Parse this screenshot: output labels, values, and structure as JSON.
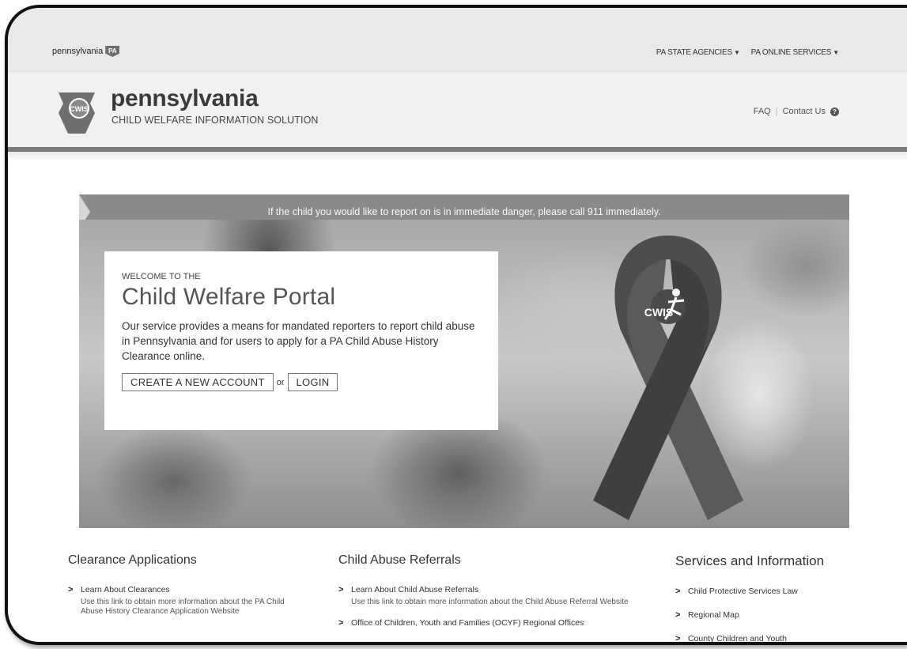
{
  "state_bar": {
    "brand_text": "pennsylvania",
    "brand_badge": "PA",
    "menus": [
      {
        "label": "PA STATE AGENCIES"
      },
      {
        "label": "PA ONLINE SERVICES"
      }
    ]
  },
  "header": {
    "logo_badge": "CWIS",
    "title": "pennsylvania",
    "subtitle": "CHILD WELFARE INFORMATION SOLUTION",
    "links": {
      "faq": "FAQ",
      "contact": "Contact Us"
    }
  },
  "alert": {
    "text": "If the child you would like to report on is in immediate danger, please call 911 immediately."
  },
  "hero": {
    "eyebrow": "WELCOME TO THE",
    "title": "Child Welfare Portal",
    "description": "Our service provides a means for mandated reporters to report child abuse in Pennsylvania and for users to apply for a PA Child Abuse History Clearance online.",
    "create_account_label": "CREATE A NEW ACCOUNT",
    "or_label": "or",
    "login_label": "LOGIN",
    "ribbon_label": "CWIS"
  },
  "columns": {
    "clearance": {
      "title": "Clearance Applications",
      "items": [
        {
          "title": "Learn About Clearances",
          "desc": "Use this link to obtain more information about the PA Child Abuse History Clearance Application Website"
        }
      ]
    },
    "referrals": {
      "title": "Child Abuse Referrals",
      "items": [
        {
          "title": "Learn About Child Abuse Referrals",
          "desc": "Use this link to obtain more information about the Child Abuse Referral Website"
        },
        {
          "title": "Office of Children, Youth and Families (OCYF) Regional Offices",
          "desc": ""
        }
      ]
    },
    "services": {
      "title": "Services and Information",
      "items": [
        {
          "title": "Child Protective Services Law"
        },
        {
          "title": "Regional Map"
        },
        {
          "title": "County Children and Youth"
        }
      ]
    }
  },
  "colors": {
    "alert_bg": "#8a8a8a",
    "header_bg": "#f1f1f1",
    "state_bar_bg": "#e9e9e9"
  }
}
